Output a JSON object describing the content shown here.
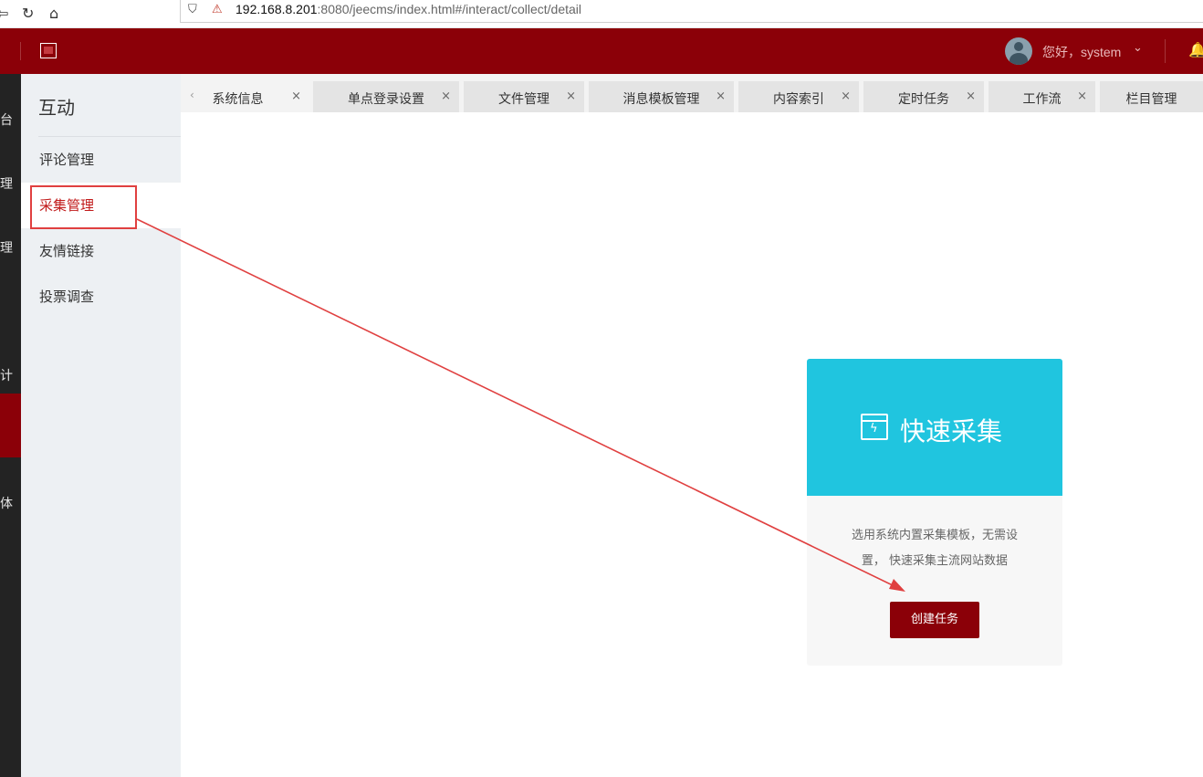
{
  "browser": {
    "url_host": "192.168.8.201",
    "url_rest": ":8080/jeecms/index.html#/interact/collect/detail"
  },
  "header": {
    "greeting": "您好，system"
  },
  "dark_sidebar": {
    "labels": [
      "台",
      "理",
      "理",
      "计",
      "体"
    ]
  },
  "sub_sidebar": {
    "title": "互动",
    "items": [
      {
        "label": "评论管理"
      },
      {
        "label": "采集管理",
        "active": true
      },
      {
        "label": "友情链接"
      },
      {
        "label": "投票调查"
      }
    ]
  },
  "tabs": [
    {
      "label": "系统信息"
    },
    {
      "label": "单点登录设置"
    },
    {
      "label": "文件管理"
    },
    {
      "label": "消息模板管理"
    },
    {
      "label": "内容索引"
    },
    {
      "label": "定时任务"
    },
    {
      "label": "工作流"
    },
    {
      "label": "栏目管理"
    }
  ],
  "tab_close_symbol": "×",
  "card": {
    "title": "快速采集",
    "desc_line1": "选用系统内置采集模板，无需设",
    "desc_line2": "置， 快速采集主流网站数据",
    "button_label": "创建任务"
  },
  "colors": {
    "brand_red": "#8b0008",
    "card_cyan": "#20c5df",
    "annotation_red": "#e04040"
  },
  "icons": {
    "back": "back-icon",
    "reload": "reload-icon",
    "home": "home-icon",
    "bell": "bell-icon",
    "card": "quick-collect-icon"
  }
}
